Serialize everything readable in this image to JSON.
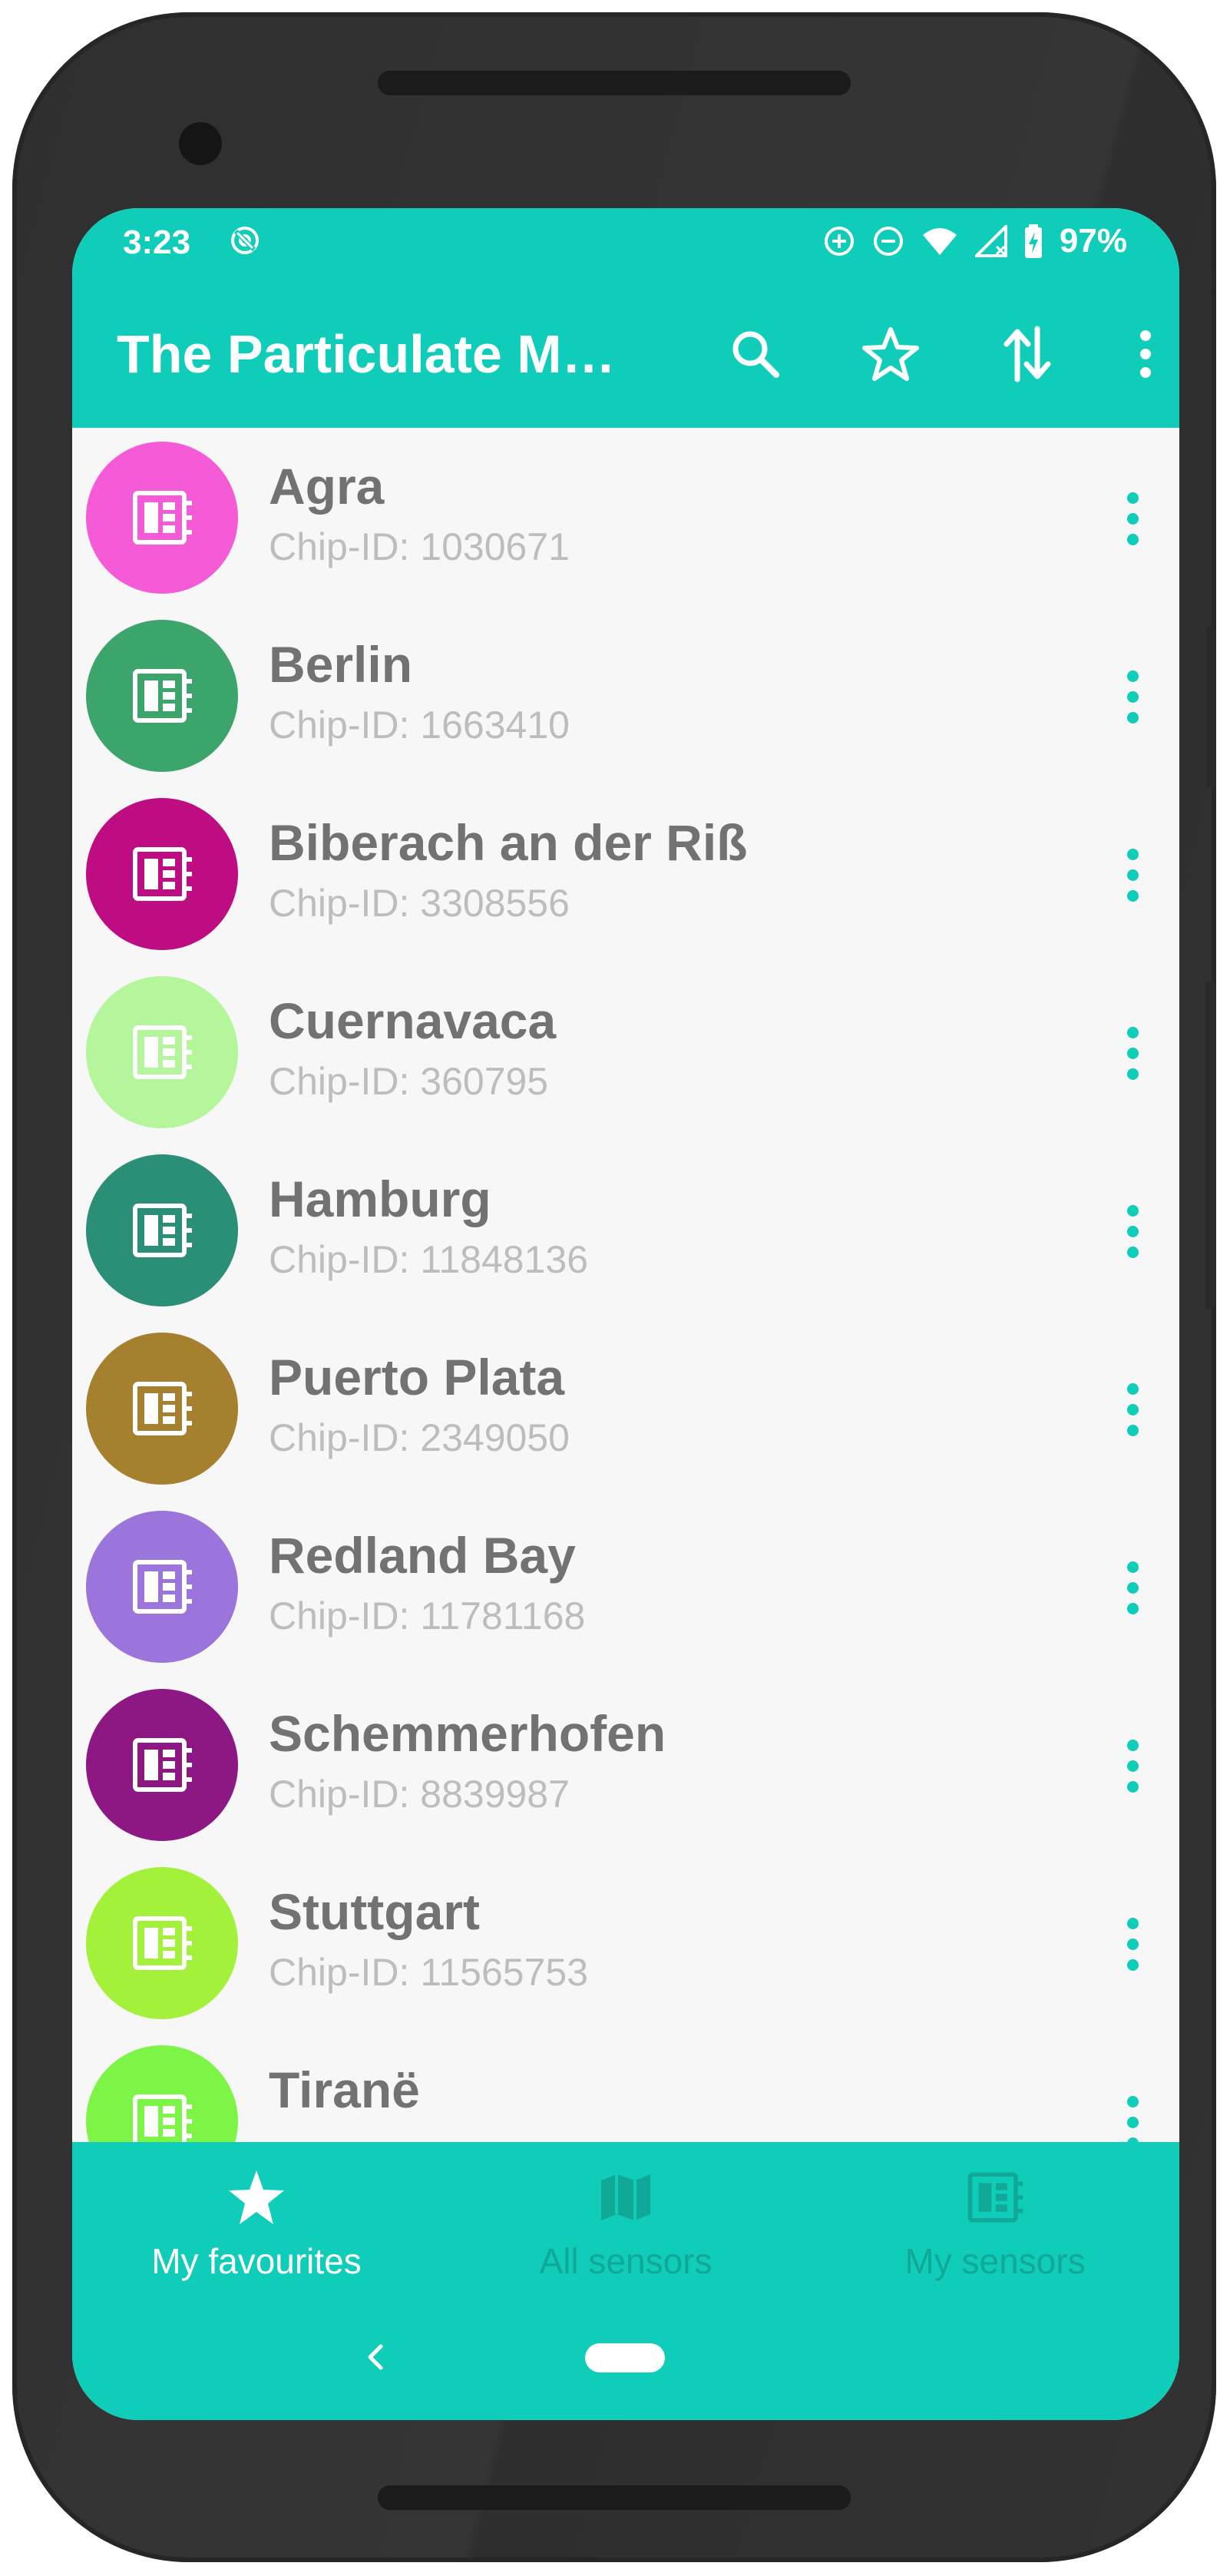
{
  "status_bar": {
    "time": "3:23",
    "battery_percent": "97%"
  },
  "app_bar": {
    "title": "The Particulate Matter App",
    "actions": [
      "search-icon",
      "star-outline-icon",
      "sort-icon",
      "more-vert-icon"
    ]
  },
  "colors": {
    "primary": "#0fcdb9",
    "title_text": "#727272",
    "subtitle_text": "#bdbdbd",
    "inactive_nav": "#12a898"
  },
  "sensors": [
    {
      "name": "Agra",
      "chip": "Chip-ID: 1030671",
      "color": "#f65bd7"
    },
    {
      "name": "Berlin",
      "chip": "Chip-ID: 1663410",
      "color": "#3ba56b"
    },
    {
      "name": "Biberach an der Riß",
      "chip": "Chip-ID: 3308556",
      "color": "#be0d82"
    },
    {
      "name": "Cuernavaca",
      "chip": "Chip-ID: 360795",
      "color": "#b5f59b"
    },
    {
      "name": "Hamburg",
      "chip": "Chip-ID: 11848136",
      "color": "#2b8e76"
    },
    {
      "name": "Puerto Plata",
      "chip": "Chip-ID: 2349050",
      "color": "#a5812f"
    },
    {
      "name": "Redland Bay",
      "chip": "Chip-ID: 11781168",
      "color": "#9b74dc"
    },
    {
      "name": "Schemmerhofen",
      "chip": "Chip-ID: 8839987",
      "color": "#8d1783"
    },
    {
      "name": "Stuttgart",
      "chip": "Chip-ID: 11565753",
      "color": "#a3f13a"
    },
    {
      "name": "Tiranë",
      "chip": "",
      "color": "#7cf547"
    }
  ],
  "bottom_nav": [
    {
      "label": "My favourites",
      "icon": "star-icon",
      "active": true
    },
    {
      "label": "All sensors",
      "icon": "map-icon",
      "active": false
    },
    {
      "label": "My sensors",
      "icon": "sensor-chip-icon",
      "active": false
    }
  ]
}
